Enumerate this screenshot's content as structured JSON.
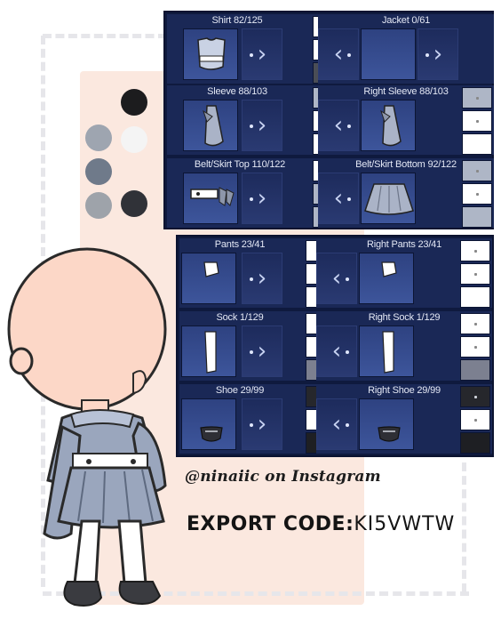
{
  "panel_top": {
    "cells": [
      {
        "label": "Shirt 82/125",
        "item": "shirt-icon"
      },
      {
        "label": "Jacket 0/61",
        "item": "none"
      },
      {
        "label": "Sleeve 88/103",
        "item": "sleeve-icon"
      },
      {
        "label": "Right Sleeve 88/103",
        "item": "sleeve-icon"
      },
      {
        "label": "Belt/Skirt Top 110/122",
        "item": "belt-icon"
      },
      {
        "label": "Belt/Skirt Bottom 92/122",
        "item": "skirt-icon"
      }
    ]
  },
  "panel_bottom": {
    "cells": [
      {
        "label": "Pants 23/41",
        "item": "pants-icon"
      },
      {
        "label": "Right Pants 23/41",
        "item": "pants-icon"
      },
      {
        "label": "Sock 1/129",
        "item": "sock-icon"
      },
      {
        "label": "Right Sock 1/129",
        "item": "sock-icon"
      },
      {
        "label": "Shoe 29/99",
        "item": "shoe-icon"
      },
      {
        "label": "Right Shoe 29/99",
        "item": "shoe-icon"
      }
    ]
  },
  "swatches": [
    "#1c1c1e",
    "#9ea5b0",
    "#f4f4f4",
    "#6f7a8a",
    "#9ea3aa",
    "#303238"
  ],
  "credit": "@ninaiic on Instagram",
  "export": {
    "label": "EXPORT CODE:",
    "code": "KI5VWTW"
  },
  "colors": {
    "panel": "#0f1a3e",
    "cell": "#1a2856",
    "preview": "#3d559b",
    "peach": "#fbe8df",
    "skin": "#fcd7c7",
    "outfit_grey": "#9aa6bd",
    "white": "#ffffff"
  }
}
